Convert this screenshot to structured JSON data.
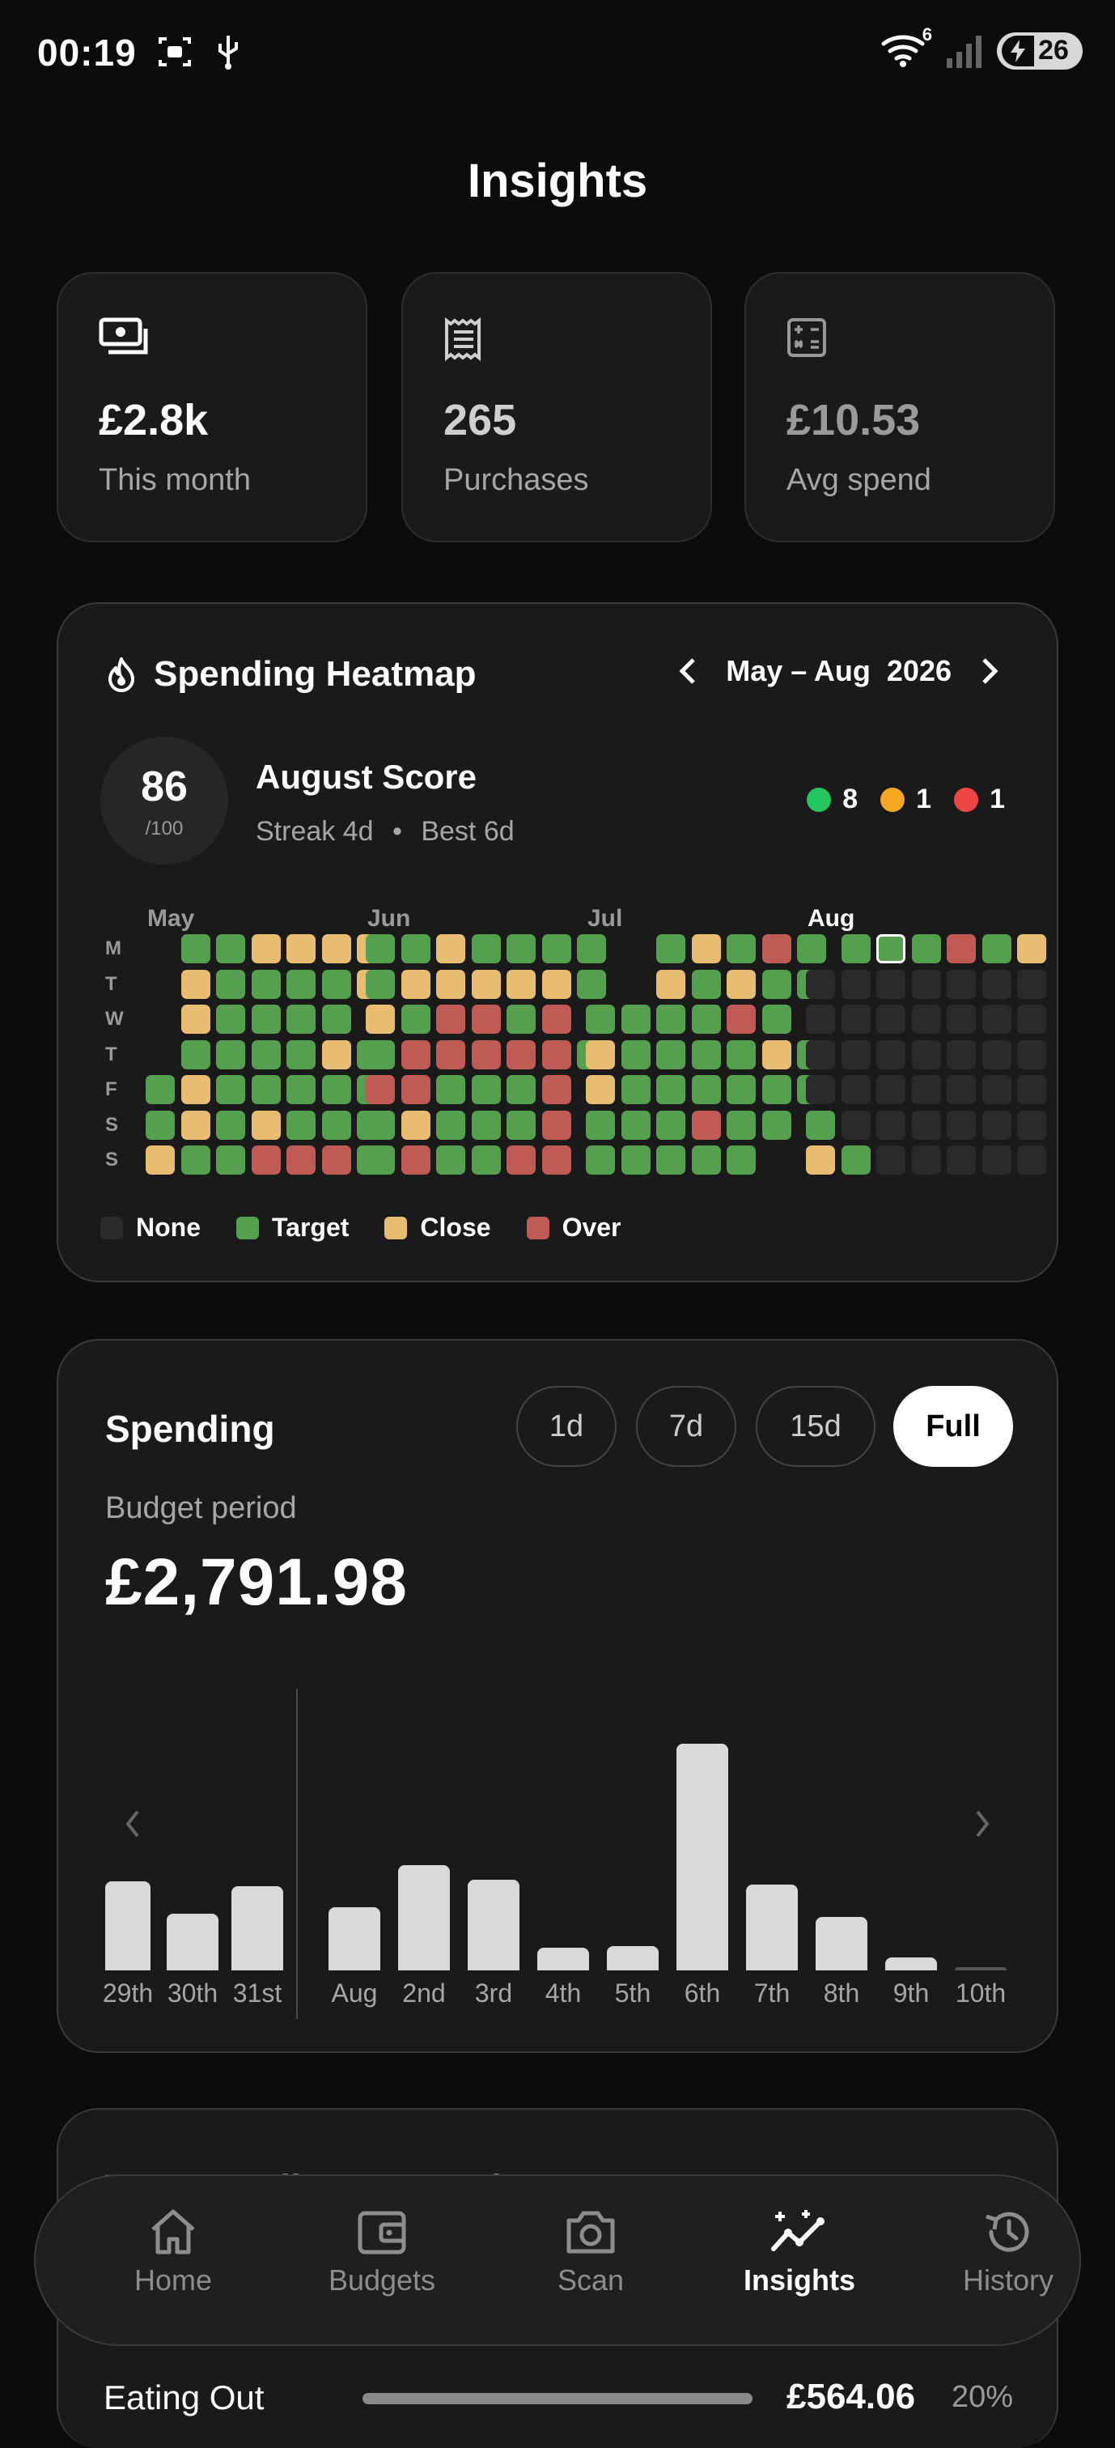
{
  "status": {
    "time": "00:19",
    "wifi_badge": "6",
    "battery": "26"
  },
  "page": {
    "title": "Insights"
  },
  "stats": [
    {
      "value": "£2.8k",
      "label": "This month"
    },
    {
      "value": "265",
      "label": "Purchases"
    },
    {
      "value": "£10.53",
      "label": "Avg spend"
    }
  ],
  "heatmap": {
    "title": "Spending Heatmap",
    "range": "May – Aug  2026",
    "score": {
      "value": "86",
      "denominator": "/100",
      "title": "August Score",
      "streak": "Streak 4d",
      "separator": "•",
      "best": "Best 6d"
    },
    "counts": [
      {
        "color": "#22c55e",
        "value": "8"
      },
      {
        "color": "#f5a623",
        "value": "1"
      },
      {
        "color": "#ef4444",
        "value": "1"
      }
    ],
    "months": [
      "May",
      "Jun",
      "Jul",
      "Aug"
    ],
    "days": [
      "M",
      "T",
      "W",
      "T",
      "F",
      "S",
      "S"
    ],
    "colors": {
      "none": "#2a2a2a",
      "target": "#55a04e",
      "close": "#e8bd72",
      "over": "#c05a55"
    },
    "grids": [
      [
        "-ggcccc",
        "-cggggc",
        "-cgggg-",
        "-ggggcg",
        "gcggggg",
        "gcgcggg",
        "cggooog"
      ],
      [
        "ggcgggg",
        "gcccccg",
        "cgoogo-",
        "gooooog",
        "oogggo-",
        "gcgggo-",
        "goggoo-"
      ],
      [
        "--gcgog",
        "--cgcgg",
        "ggggog-",
        "cggggcg",
        "cgggggg",
        "gggogg-",
        "ggggg--"
      ],
      [
        "-gggogc",
        "nnnnnnn",
        "nnnnnnn",
        "nnnnnnn",
        "nnnnnnn",
        "gnnnnnn",
        "cgnnnnn"
      ]
    ],
    "legend": [
      "None",
      "Target",
      "Close",
      "Over"
    ]
  },
  "spending": {
    "title": "Spending",
    "ranges": [
      "1d",
      "7d",
      "15d",
      "Full"
    ],
    "active_range": "Full",
    "subtitle": "Budget period",
    "total": "£2,791.98"
  },
  "chart_data": {
    "type": "bar",
    "categories": [
      "29th",
      "30th",
      "31st",
      "Aug",
      "2nd",
      "3rd",
      "4th",
      "5th",
      "6th",
      "7th",
      "8th",
      "9th",
      "10th"
    ],
    "values": [
      110,
      70,
      104,
      78,
      130,
      112,
      28,
      30,
      280,
      106,
      66,
      16,
      4
    ],
    "ylim": [
      0,
      300
    ]
  },
  "categories_section": {
    "title": "Top spending categories",
    "row": {
      "name": "Eating Out",
      "amount": "£564.06",
      "percent": "20%"
    }
  },
  "nav": [
    {
      "label": "Home",
      "icon": "home-icon"
    },
    {
      "label": "Budgets",
      "icon": "wallet-icon"
    },
    {
      "label": "Scan",
      "icon": "camera-icon"
    },
    {
      "label": "Insights",
      "icon": "insights-icon"
    },
    {
      "label": "History",
      "icon": "history-icon"
    }
  ]
}
